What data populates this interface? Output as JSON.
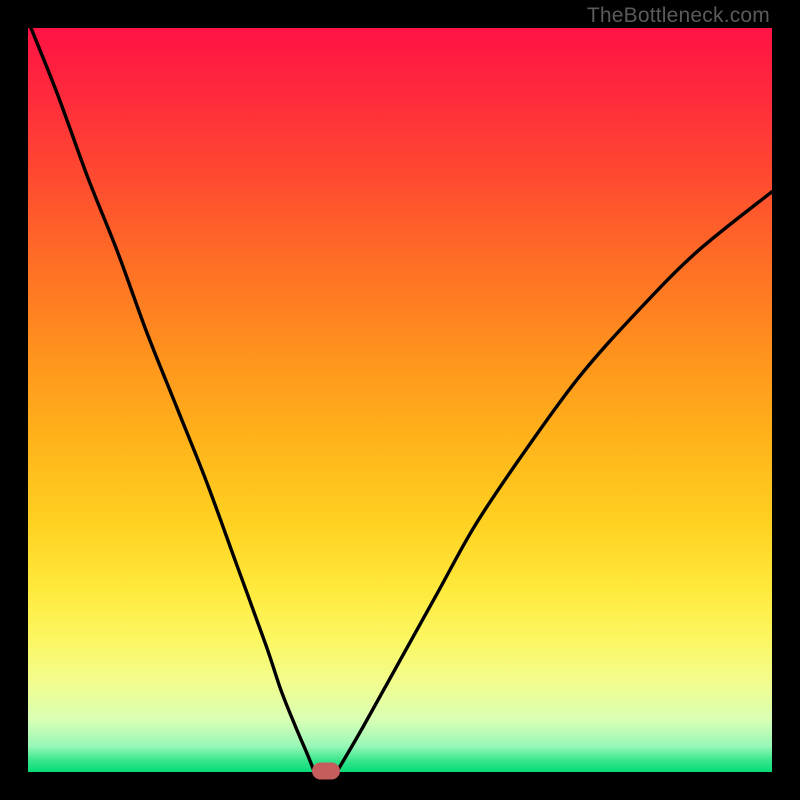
{
  "watermark": "TheBottleneck.com",
  "colors": {
    "frame": "#000000",
    "gradient_top": "#ff1244",
    "gradient_bottom": "#06da78",
    "curve": "#000000",
    "marker": "#c55d5d",
    "watermark_text": "#5a5a5a"
  },
  "chart_data": {
    "type": "line",
    "title": "",
    "xlabel": "",
    "ylabel": "",
    "xlim": [
      0,
      100
    ],
    "ylim": [
      0,
      100
    ],
    "series": [
      {
        "name": "bottleneck-curve",
        "x": [
          0,
          4,
          8,
          12,
          16,
          20,
          24,
          28,
          32,
          34,
          36,
          37.5,
          39,
          40,
          41,
          45,
          50,
          55,
          60,
          66,
          74,
          82,
          90,
          100
        ],
        "y": [
          101,
          91,
          80,
          70,
          59,
          49,
          39,
          28,
          17,
          11,
          6,
          2.5,
          0.5,
          0,
          0.5,
          6,
          15,
          24,
          33,
          42,
          53,
          62,
          70,
          78
        ]
      }
    ],
    "marker": {
      "x": 40,
      "y": 0,
      "name": "optimal-point"
    },
    "flat_segment": {
      "x_start": 38.5,
      "x_end": 41.5,
      "y": 0
    }
  }
}
